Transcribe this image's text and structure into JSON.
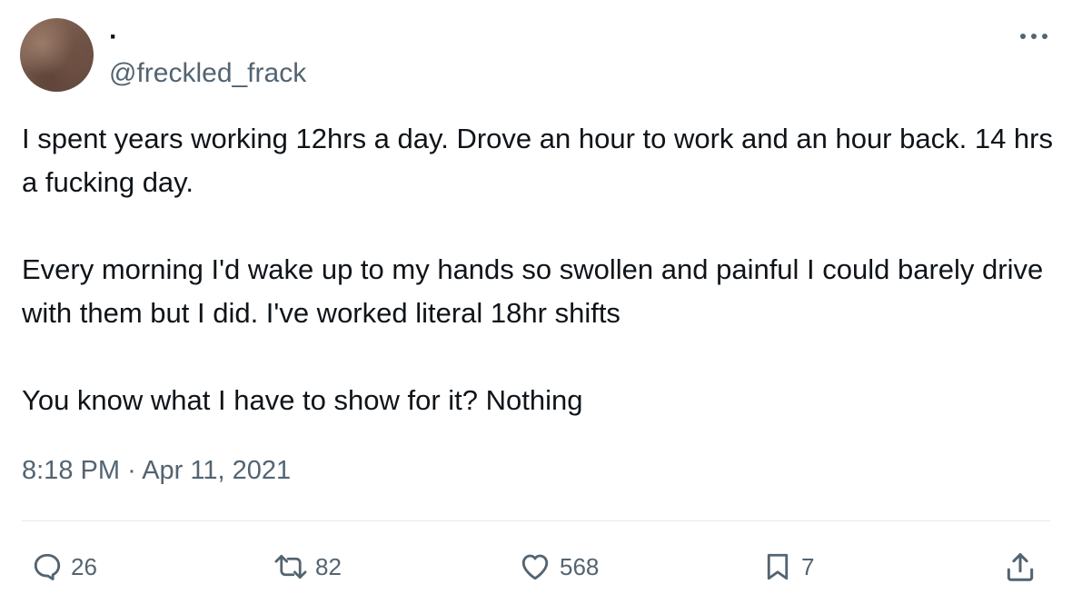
{
  "author": {
    "display_name": "·",
    "handle": "@freckled_frack"
  },
  "tweet": {
    "paragraphs": [
      "I spent years working 12hrs a day. Drove an hour to work and an hour back. 14 hrs a fucking day.",
      "Every morning I'd wake up to my hands so swollen and painful I could barely drive with them but I did. I've worked literal 18hr shifts",
      "You know what I have to show for it? Nothing"
    ],
    "time": "8:18 PM",
    "separator": "·",
    "date": "Apr 11, 2021"
  },
  "actions": {
    "replies": "26",
    "retweets": "82",
    "likes": "568",
    "bookmarks": "7"
  },
  "icons": {
    "more": "more-horizontal-icon",
    "reply": "reply-bubble-icon",
    "retweet": "retweet-icon",
    "like": "heart-icon",
    "bookmark": "bookmark-icon",
    "share": "share-upload-icon"
  },
  "colors": {
    "text": "#0f1419",
    "secondary": "#536471",
    "divider": "#e7e9ea"
  }
}
